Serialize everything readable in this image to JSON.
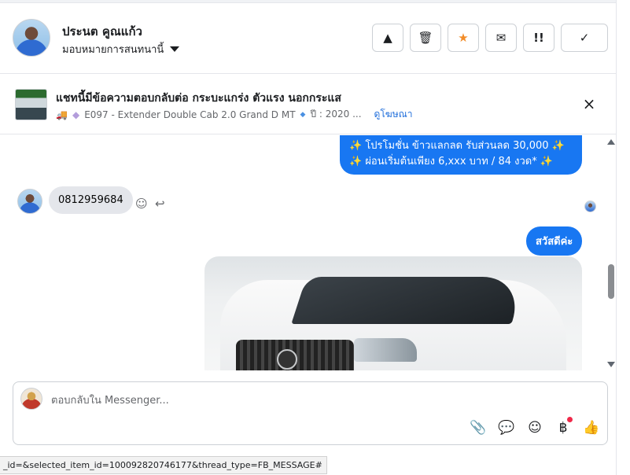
{
  "header": {
    "user_name": "ประนต คูณแก้ว",
    "assign_label": "มอบหมายการสนทนานี้",
    "tools": [
      {
        "icon": "warning-icon",
        "glyph": "▲"
      },
      {
        "icon": "trash-icon",
        "glyph": "🗑"
      },
      {
        "icon": "star-icon",
        "glyph": "★"
      },
      {
        "icon": "envelope-icon",
        "glyph": "✉"
      },
      {
        "icon": "exclamation-icon",
        "glyph": "!!"
      },
      {
        "icon": "check-icon",
        "glyph": "✓"
      }
    ],
    "colors": {
      "star": "#f28c28"
    }
  },
  "ad": {
    "title": "แชทนี้มีข้อความตอบกลับต่อ กระบะแกร่ง ตัวแรง นอกกระแส",
    "meta_code": "E097 - Extender Double Cab 2.0 Grand D MT",
    "meta_year": "ปี : 2020 ...",
    "view_ad": "ดูโฆษณา",
    "close": "×"
  },
  "conversation": {
    "promo_line1": "✨ โปรโมชั่น ข้าวแลกลด รับส่วนลด 30,000 ✨",
    "promo_line2": "✨ ผ่อนเริ่มต้นเพียง 6,xxx บาท / 84 งวด* ✨",
    "phone": "0812959684",
    "hello": "สวัสดีค่ะ"
  },
  "composer": {
    "placeholder": "ตอบกลับใน Messenger..."
  },
  "status_url": "_id=&selected_item_id=100092820746177&thread_type=FB_MESSAGE#",
  "colors": {
    "accent": "#1877f2",
    "link": "#216fdb",
    "incoming_bubble": "#e4e6eb",
    "badge_dot": "#f02849"
  }
}
